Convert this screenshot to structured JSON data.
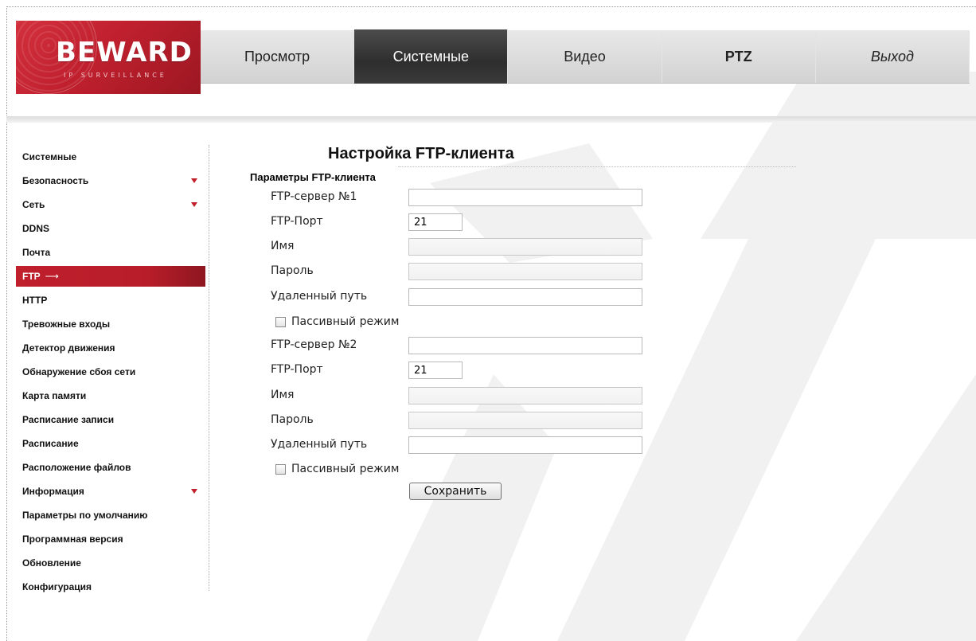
{
  "logo": {
    "brand": "BEWARD",
    "tagline": "IP SURVEILLANCE"
  },
  "nav": {
    "tabs": [
      {
        "label": "Просмотр",
        "active": false
      },
      {
        "label": "Системные",
        "active": true
      },
      {
        "label": "Видео",
        "active": false
      },
      {
        "label": "PTZ",
        "active": false
      },
      {
        "label": "Выход",
        "active": false
      }
    ]
  },
  "sidebar": {
    "items": [
      {
        "label": "Системные",
        "expandable": false
      },
      {
        "label": "Безопасность",
        "expandable": true
      },
      {
        "label": "Сеть",
        "expandable": true
      },
      {
        "label": "DDNS",
        "expandable": false
      },
      {
        "label": "Почта",
        "expandable": false
      },
      {
        "label": "FTP",
        "active": true,
        "arrow": "⟶"
      },
      {
        "label": "HTTP",
        "expandable": false
      },
      {
        "label": "Тревожные входы",
        "expandable": false
      },
      {
        "label": "Детектор движения",
        "expandable": false
      },
      {
        "label": "Обнаружение сбоя сети",
        "expandable": false
      },
      {
        "label": "Карта памяти",
        "expandable": false
      },
      {
        "label": "Расписание записи",
        "expandable": false
      },
      {
        "label": "Расписание",
        "expandable": false
      },
      {
        "label": "Расположение файлов",
        "expandable": false
      },
      {
        "label": "Информация",
        "expandable": true
      },
      {
        "label": "Параметры по умолчанию",
        "expandable": false
      },
      {
        "label": "Программная версия",
        "expandable": false
      },
      {
        "label": "Обновление",
        "expandable": false
      },
      {
        "label": "Конфигурация",
        "expandable": false
      }
    ],
    "accent_color": "#c01f2c"
  },
  "content": {
    "title": "Настройка FTP-клиента",
    "section": "Параметры FTP-клиента",
    "server1": {
      "server_label": "FTP-сервер №1",
      "server_value": "",
      "port_label": "FTP-Порт",
      "port_value": "21",
      "name_label": "Имя",
      "name_value": "",
      "password_label": "Пароль",
      "password_value": "",
      "path_label": "Удаленный путь",
      "path_value": "",
      "passive_label": "Пассивный режим",
      "passive_checked": false
    },
    "server2": {
      "server_label": "FTP-сервер №2",
      "server_value": "",
      "port_label": "FTP-Порт",
      "port_value": "21",
      "name_label": "Имя",
      "name_value": "",
      "password_label": "Пароль",
      "password_value": "",
      "path_label": "Удаленный путь",
      "path_value": "",
      "passive_label": "Пассивный режим",
      "passive_checked": false
    },
    "save_label": "Сохранить"
  }
}
